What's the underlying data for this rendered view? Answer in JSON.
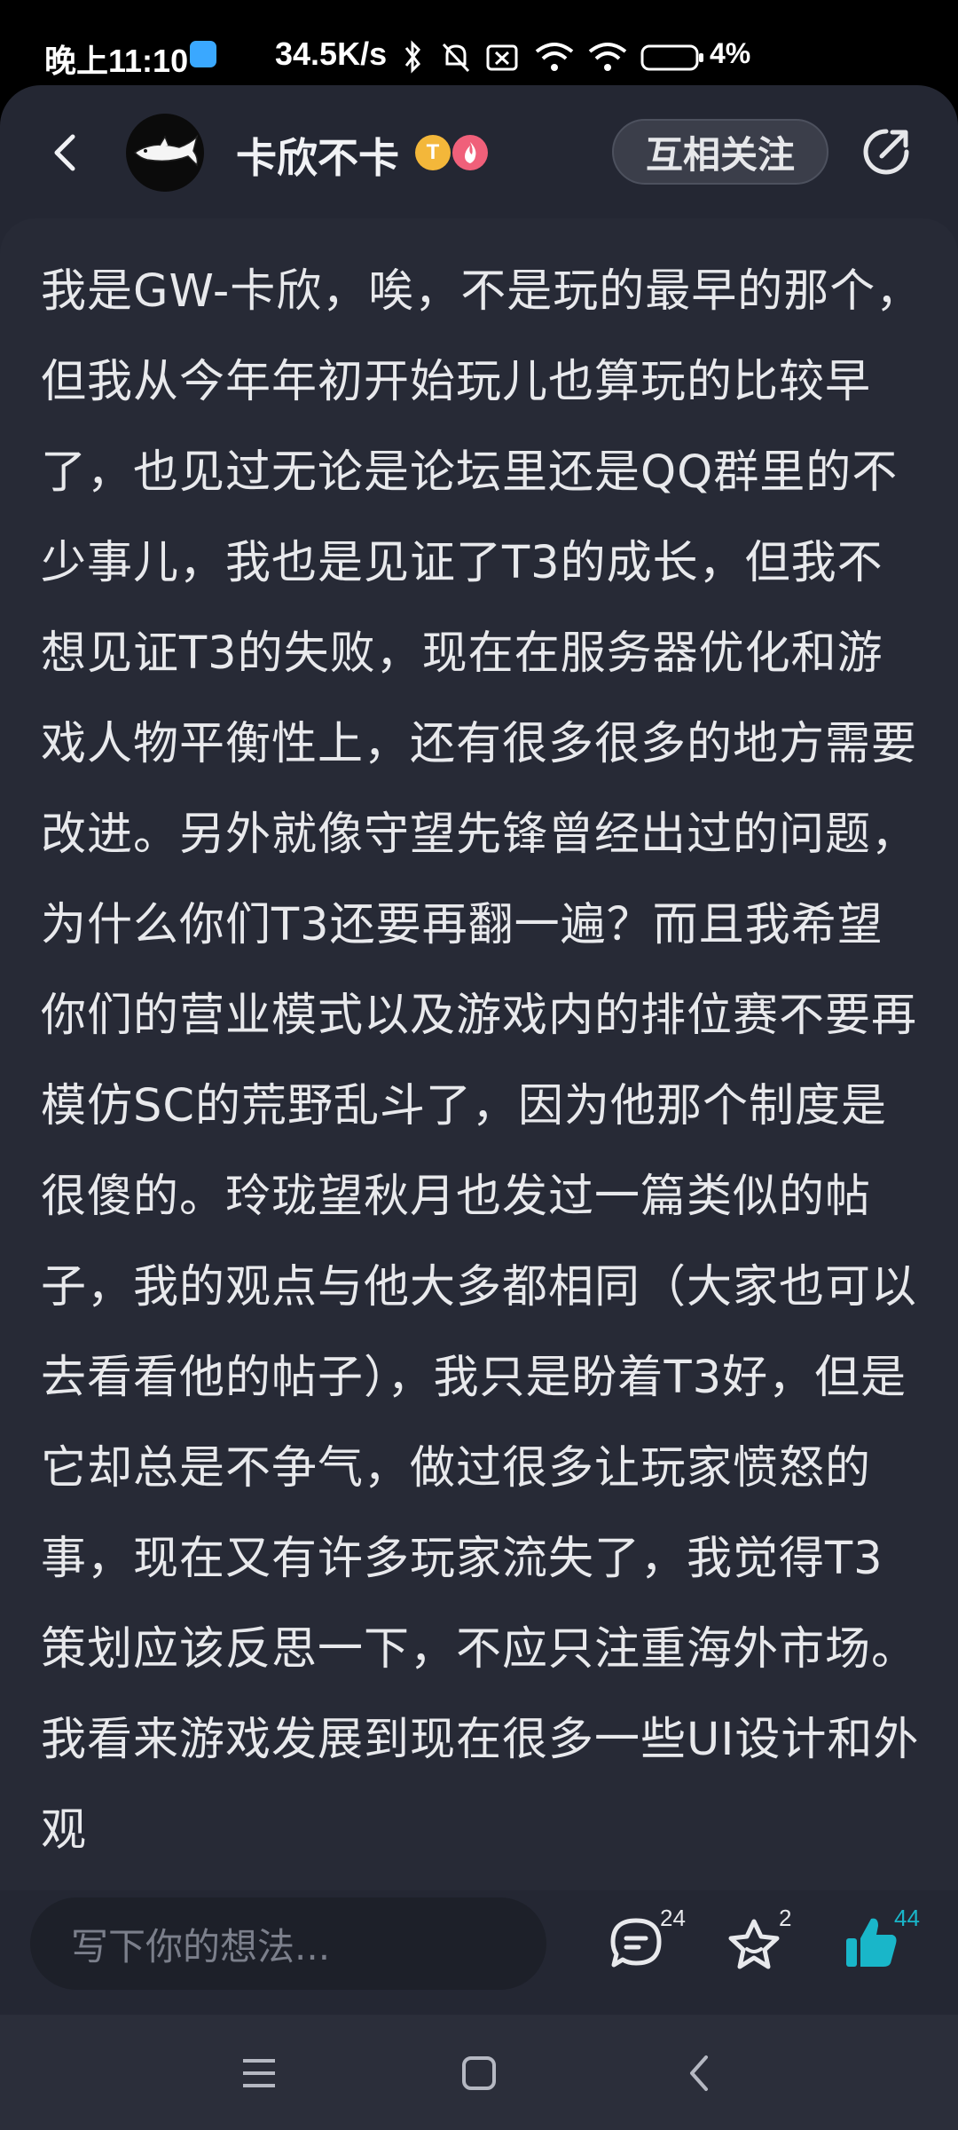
{
  "status_bar": {
    "time": "晚上11:10",
    "net_speed": "34.5K/s",
    "battery": "4%"
  },
  "header": {
    "username": "卡欣不卡",
    "badge_letter": "T",
    "follow_label": "互相关注"
  },
  "post": {
    "body": "我是GW-卡欣，唉，不是玩的最早的那个，但我从今年年初开始玩儿也算玩的比较早了，也见过无论是论坛里还是QQ群里的不少事儿，我也是见证了T3的成长，但我不想见证T3的失败，现在在服务器优化和游戏人物平衡性上，还有很多很多的地方需要改进。另外就像守望先锋曾经出过的问题，为什么你们T3还要再翻一遍？而且我希望你们的营业模式以及游戏内的排位赛不要再模仿SC的荒野乱斗了，因为他那个制度是很傻的。玲珑望秋月也发过一篇类似的帖子，我的观点与他大多都相同（大家也可以去看看他的帖子），我只是盼着T3好，但是它却总是不争气，做过很多让玩家愤怒的事，现在又有许多玩家流失了，我觉得T3策划应该反思一下，不应只注重海外市场。我看来游戏发展到现在很多一些UI设计和外观"
  },
  "bottom_bar": {
    "comment_placeholder": "写下你的想法...",
    "comment_count": "24",
    "favorite_count": "2",
    "like_count": "44",
    "like_color": "#19b6c9"
  },
  "icons": [
    "back-arrow-icon",
    "share-icon",
    "comment-icon",
    "star-icon",
    "thumbs-up-icon",
    "menu-icon",
    "home-icon",
    "nav-back-icon"
  ]
}
